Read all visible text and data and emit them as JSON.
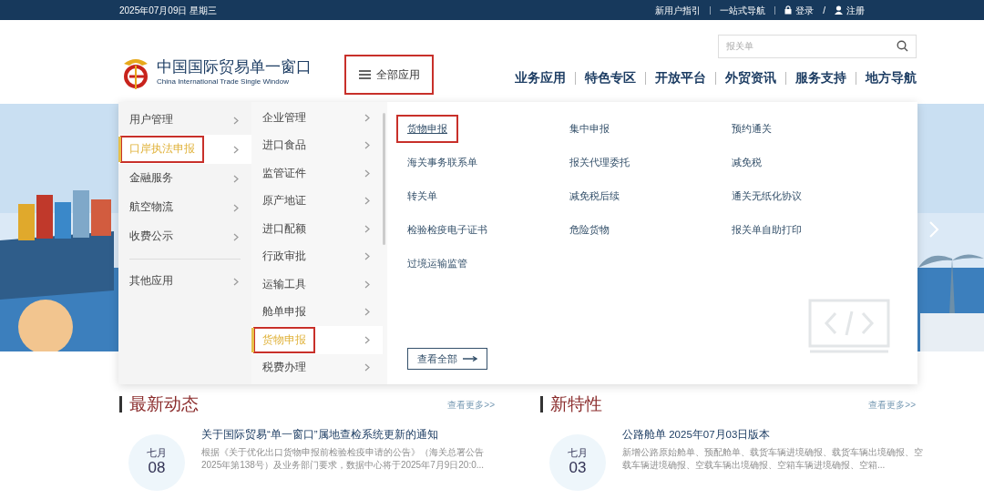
{
  "top_bar": {
    "date": "2025年07月09日 星期三",
    "links": [
      "新用户指引",
      "一站式导航"
    ],
    "login": "登录",
    "separator": "/",
    "register": "注册"
  },
  "header": {
    "logo_title": "中国国际贸易单一窗口",
    "logo_subtitle": "China International Trade Single Window",
    "all_apps": {
      "label": "全部应用",
      "highlighted": true
    },
    "search": {
      "placeholder": "报关单"
    },
    "nav": [
      "业务应用",
      "特色专区",
      "开放平台",
      "外贸资讯",
      "服务支持",
      "地方导航"
    ]
  },
  "menu": {
    "categories": [
      {
        "label": "用户管理",
        "selected": false,
        "highlighted": false
      },
      {
        "label": "口岸执法申报",
        "selected": true,
        "highlighted": true
      },
      {
        "label": "金融服务",
        "selected": false,
        "highlighted": false
      },
      {
        "label": "航空物流",
        "selected": false,
        "highlighted": false
      },
      {
        "label": "收费公示",
        "selected": false,
        "highlighted": false
      },
      {
        "label": "其他应用",
        "selected": false,
        "highlighted": false
      }
    ],
    "subcategories": [
      {
        "label": "企业管理",
        "selected": false,
        "highlighted": false
      },
      {
        "label": "进口食品",
        "selected": false,
        "highlighted": false
      },
      {
        "label": "监管证件",
        "selected": false,
        "highlighted": false
      },
      {
        "label": "原产地证",
        "selected": false,
        "highlighted": false
      },
      {
        "label": "进口配额",
        "selected": false,
        "highlighted": false
      },
      {
        "label": "行政审批",
        "selected": false,
        "highlighted": false
      },
      {
        "label": "运输工具",
        "selected": false,
        "highlighted": false
      },
      {
        "label": "舱单申报",
        "selected": false,
        "highlighted": false
      },
      {
        "label": "货物申报",
        "selected": true,
        "highlighted": true
      },
      {
        "label": "税费办理",
        "selected": false,
        "highlighted": false
      }
    ],
    "apps": [
      {
        "label": "货物申报",
        "highlighted": true
      },
      {
        "label": "集中申报",
        "highlighted": false
      },
      {
        "label": "预约通关",
        "highlighted": false
      },
      {
        "label": "海关事务联系单",
        "highlighted": false
      },
      {
        "label": "报关代理委托",
        "highlighted": false
      },
      {
        "label": "减免税",
        "highlighted": false
      },
      {
        "label": "转关单",
        "highlighted": false
      },
      {
        "label": "减免税后续",
        "highlighted": false
      },
      {
        "label": "通关无纸化协议",
        "highlighted": false
      },
      {
        "label": "检验检疫电子证书",
        "highlighted": false
      },
      {
        "label": "危险货物",
        "highlighted": false
      },
      {
        "label": "报关单自助打印",
        "highlighted": false
      },
      {
        "label": "过境运输监管",
        "highlighted": false
      }
    ],
    "view_all": "查看全部"
  },
  "sections": [
    {
      "title": "最新动态",
      "more": "查看更多>>",
      "news": [
        {
          "month": "七月",
          "day": "08",
          "title": "关于国际贸易“单一窗口”属地查检系统更新的通知",
          "summary": "根据《关于优化出口货物申报前检验检疫申请的公告》（海关总署公告2025年第138号）及业务部门要求，数据中心将于2025年7月9日20:0..."
        }
      ]
    },
    {
      "title": "新特性",
      "more": "查看更多>>",
      "news": [
        {
          "month": "七月",
          "day": "03",
          "title": "公路舱单 2025年07月03日版本",
          "summary": "新增公路原始舱单、预配舱单、载货车辆进境确报、载货车辆出境确报、空载车辆进境确报、空载车辆出境确报、空箱车辆进境确报、空箱..."
        }
      ]
    }
  ]
}
